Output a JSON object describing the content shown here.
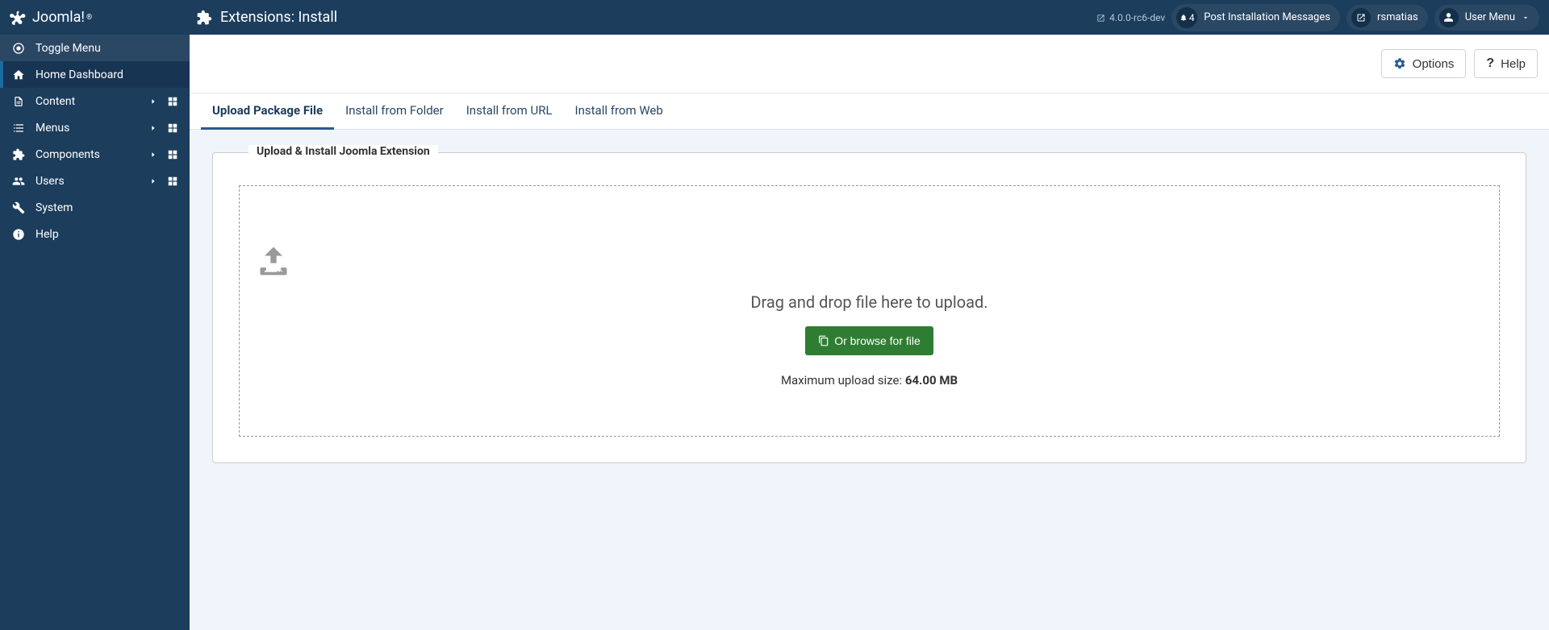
{
  "header": {
    "brand": "Joomla!",
    "page_title": "Extensions: Install",
    "version": "4.0.0-rc6-dev",
    "notifications": {
      "count": "4",
      "label": "Post Installation Messages"
    },
    "user_link": "rsmatias",
    "user_menu": "User Menu"
  },
  "sidebar": {
    "toggle": "Toggle Menu",
    "items": [
      {
        "label": "Home Dashboard",
        "icon": "home",
        "expandable": false,
        "dash": false
      },
      {
        "label": "Content",
        "icon": "file",
        "expandable": true,
        "dash": true
      },
      {
        "label": "Menus",
        "icon": "list",
        "expandable": true,
        "dash": true
      },
      {
        "label": "Components",
        "icon": "puzzle",
        "expandable": true,
        "dash": true
      },
      {
        "label": "Users",
        "icon": "users",
        "expandable": true,
        "dash": true
      },
      {
        "label": "System",
        "icon": "wrench",
        "expandable": false,
        "dash": false
      },
      {
        "label": "Help",
        "icon": "info",
        "expandable": false,
        "dash": false
      }
    ]
  },
  "toolbar": {
    "options": "Options",
    "help": "Help"
  },
  "tabs": [
    {
      "label": "Upload Package File"
    },
    {
      "label": "Install from Folder"
    },
    {
      "label": "Install from URL"
    },
    {
      "label": "Install from Web"
    }
  ],
  "upload": {
    "legend": "Upload & Install Joomla Extension",
    "drop_text": "Drag and drop file here to upload.",
    "browse_btn": "Or browse for file",
    "max_label": "Maximum upload size: ",
    "max_value": "64.00 MB"
  }
}
